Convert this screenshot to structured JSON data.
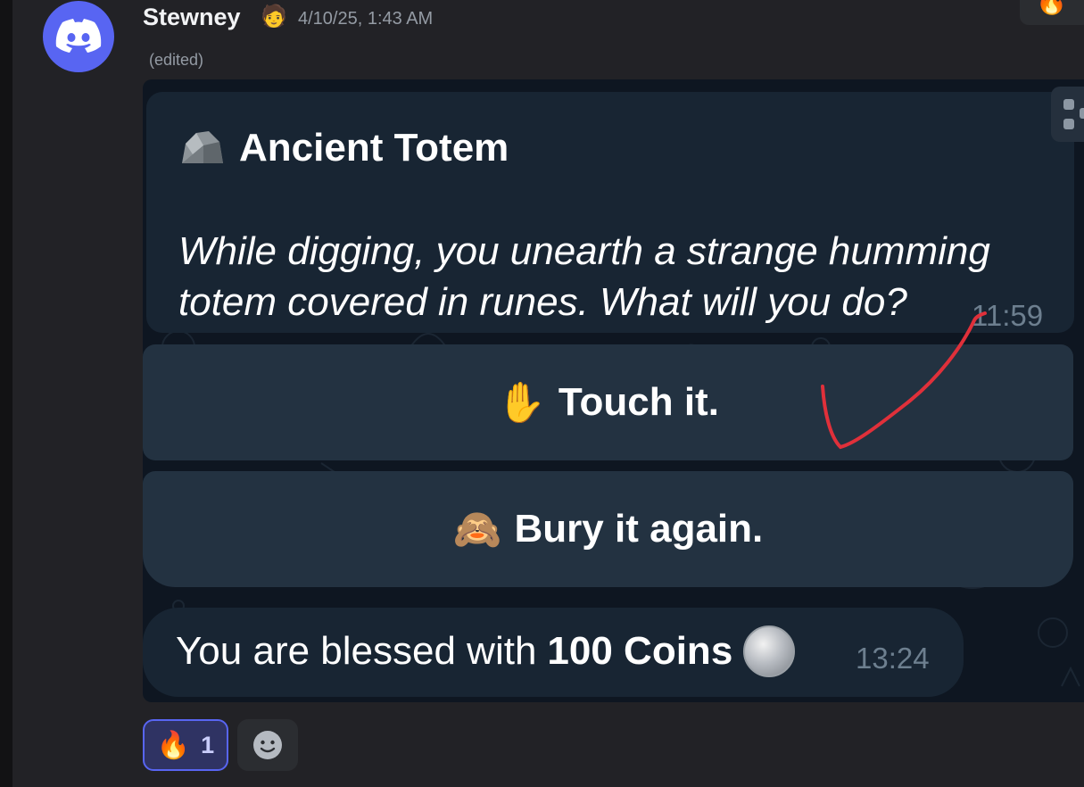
{
  "message": {
    "username": "Stewney",
    "role_icon": "🧑",
    "timestamp": "4/10/25, 1:43 AM",
    "edited": "(edited)",
    "avatar_icon": "discord-logo-icon"
  },
  "corner_reaction": {
    "emoji": "🔥"
  },
  "screenshot": {
    "card_title": "Ancient Totem",
    "card_icon": "rock-icon",
    "card_text": "While digging, you unearth a strange humming totem covered in runes. What will you do?",
    "card_time": "11:59",
    "buttons": [
      {
        "emoji": "✋",
        "label": "Touch it."
      },
      {
        "emoji": "🙈",
        "label": "Bury it again."
      }
    ],
    "reply": {
      "prefix": "You are blessed with",
      "bold": "100 Coins",
      "coin_icon": "silver-coin-icon",
      "time": "13:24"
    },
    "annotation": {
      "icon": "red-checkmark-icon",
      "color": "#e0303a"
    }
  },
  "reactions": [
    {
      "emoji": "🔥",
      "count": "1"
    }
  ],
  "add_reaction_icon": "smiley-icon",
  "colors": {
    "accent": "#5865f2",
    "chat_bg": "#0e1621",
    "bubble": "#182533",
    "button": "#233241"
  }
}
